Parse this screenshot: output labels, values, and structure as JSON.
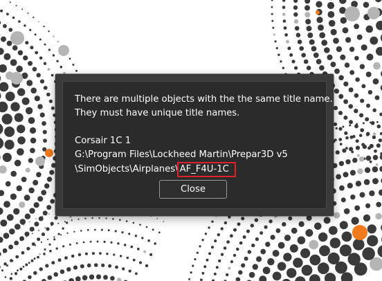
{
  "dialog": {
    "message_line1": "There are multiple objects with the the same title name.",
    "message_line2": "They must have unique title names.",
    "object_title": "Corsair 1C 1",
    "path_line1": "G:\\Program Files\\Lockheed Martin\\Prepar3D v5",
    "path_line2_prefix": "\\SimObjects\\Airplanes\\",
    "path_highlight": "AF_F4U-1C",
    "close_label": "Close"
  },
  "colors": {
    "dot_dark": "#3a3a3a",
    "dot_gray": "#b5b5b5",
    "dot_accent": "#f07a1e",
    "highlight_border": "#e0202a"
  }
}
